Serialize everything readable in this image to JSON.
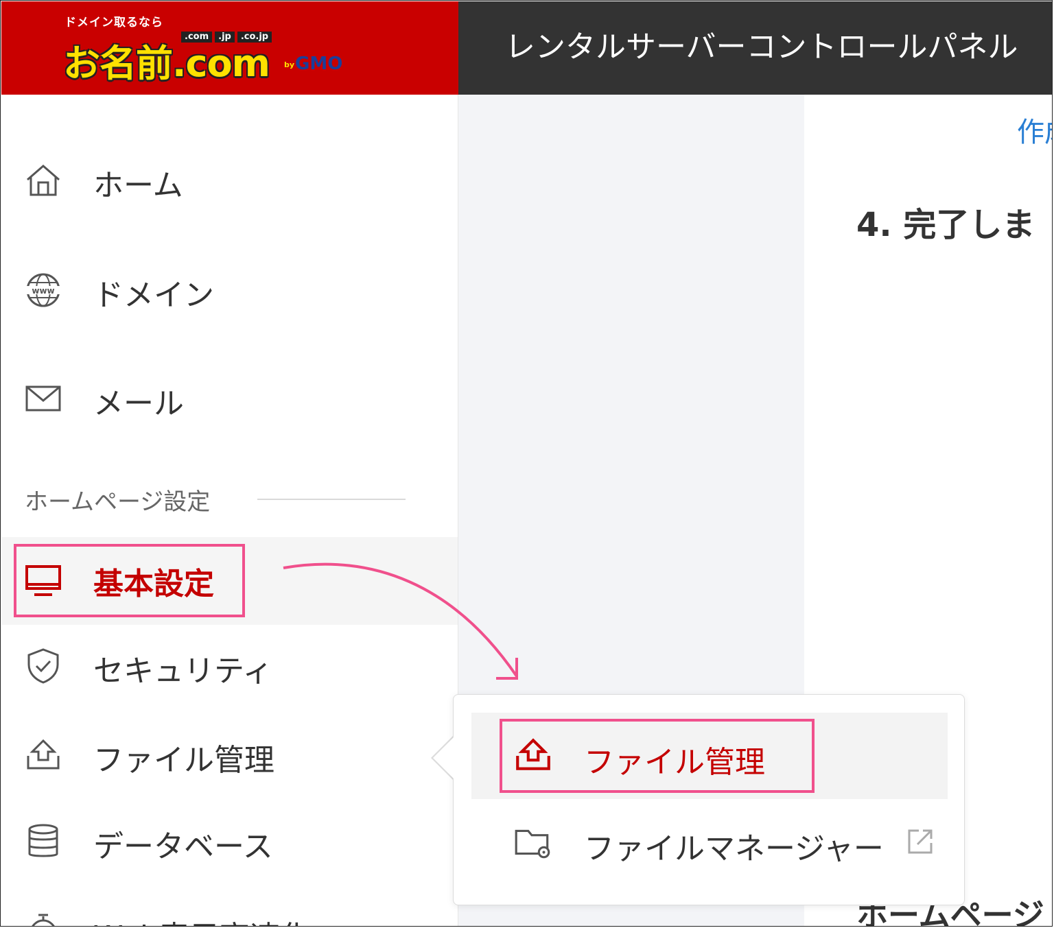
{
  "header": {
    "logo_tagline": "ドメイン取るなら",
    "logo_tlds": [
      ".com",
      ".jp",
      ".co.jp"
    ],
    "logo_main": "お名前.com",
    "logo_by": "by",
    "logo_gmo": "GMO",
    "panel_title": "レンタルサーバーコントロールパネル"
  },
  "sidebar": {
    "items": [
      {
        "label": "ホーム",
        "icon": "home-icon"
      },
      {
        "label": "ドメイン",
        "icon": "globe-www-icon"
      },
      {
        "label": "メール",
        "icon": "mail-icon"
      }
    ],
    "section_label": "ホームページ設定",
    "section_items": [
      {
        "label": "基本設定",
        "icon": "monitor-icon",
        "active": true
      },
      {
        "label": "セキュリティ",
        "icon": "shield-check-icon"
      },
      {
        "label": "ファイル管理",
        "icon": "upload-icon"
      },
      {
        "label": "データベース",
        "icon": "database-icon"
      },
      {
        "label": "Web表示高速化",
        "icon": "speed-icon"
      }
    ]
  },
  "main": {
    "link_partial": "作成",
    "heading_partial": "4. 完了しま",
    "bottom_partial": "ホームページ"
  },
  "flyout": {
    "items": [
      {
        "label": "ファイル管理",
        "icon": "upload-icon",
        "active": true
      },
      {
        "label": "ファイルマネージャー",
        "icon": "folder-gear-icon",
        "external": true
      }
    ]
  },
  "colors": {
    "brand_red": "#c90000",
    "active_red": "#c40000",
    "highlight_pink": "#f0508c",
    "header_dark": "#333333",
    "link_blue": "#2a7fd4"
  }
}
